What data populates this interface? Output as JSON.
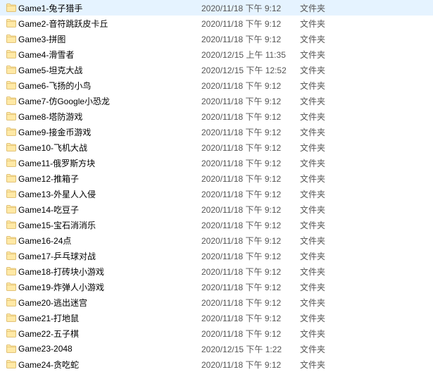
{
  "type_label": "文件夹",
  "items": [
    {
      "name": "Game1-兔子猎手",
      "date": "2020/11/18 下午 9:12"
    },
    {
      "name": "Game2-音符跳跃皮卡丘",
      "date": "2020/11/18 下午 9:12"
    },
    {
      "name": "Game3-拼图",
      "date": "2020/11/18 下午 9:12"
    },
    {
      "name": "Game4-滑雪者",
      "date": "2020/12/15 上午 11:35"
    },
    {
      "name": "Game5-坦克大战",
      "date": "2020/12/15 下午 12:52"
    },
    {
      "name": "Game6-飞扬的小鸟",
      "date": "2020/11/18 下午 9:12"
    },
    {
      "name": "Game7-仿Google小恐龙",
      "date": "2020/11/18 下午 9:12"
    },
    {
      "name": "Game8-塔防游戏",
      "date": "2020/11/18 下午 9:12"
    },
    {
      "name": "Game9-接金币游戏",
      "date": "2020/11/18 下午 9:12"
    },
    {
      "name": "Game10-飞机大战",
      "date": "2020/11/18 下午 9:12"
    },
    {
      "name": "Game11-俄罗斯方块",
      "date": "2020/11/18 下午 9:12"
    },
    {
      "name": "Game12-推箱子",
      "date": "2020/11/18 下午 9:12"
    },
    {
      "name": "Game13-外星人入侵",
      "date": "2020/11/18 下午 9:12"
    },
    {
      "name": "Game14-吃豆子",
      "date": "2020/11/18 下午 9:12"
    },
    {
      "name": "Game15-宝石消消乐",
      "date": "2020/11/18 下午 9:12"
    },
    {
      "name": "Game16-24点",
      "date": "2020/11/18 下午 9:12"
    },
    {
      "name": "Game17-乒乓球对战",
      "date": "2020/11/18 下午 9:12"
    },
    {
      "name": "Game18-打砖块小游戏",
      "date": "2020/11/18 下午 9:12"
    },
    {
      "name": "Game19-炸弹人小游戏",
      "date": "2020/11/18 下午 9:12"
    },
    {
      "name": "Game20-逃出迷宫",
      "date": "2020/11/18 下午 9:12"
    },
    {
      "name": "Game21-打地鼠",
      "date": "2020/11/18 下午 9:12"
    },
    {
      "name": "Game22-五子棋",
      "date": "2020/11/18 下午 9:12"
    },
    {
      "name": "Game23-2048",
      "date": "2020/12/15 下午 1:22"
    },
    {
      "name": "Game24-贪吃蛇",
      "date": "2020/11/18 下午 9:12"
    }
  ]
}
